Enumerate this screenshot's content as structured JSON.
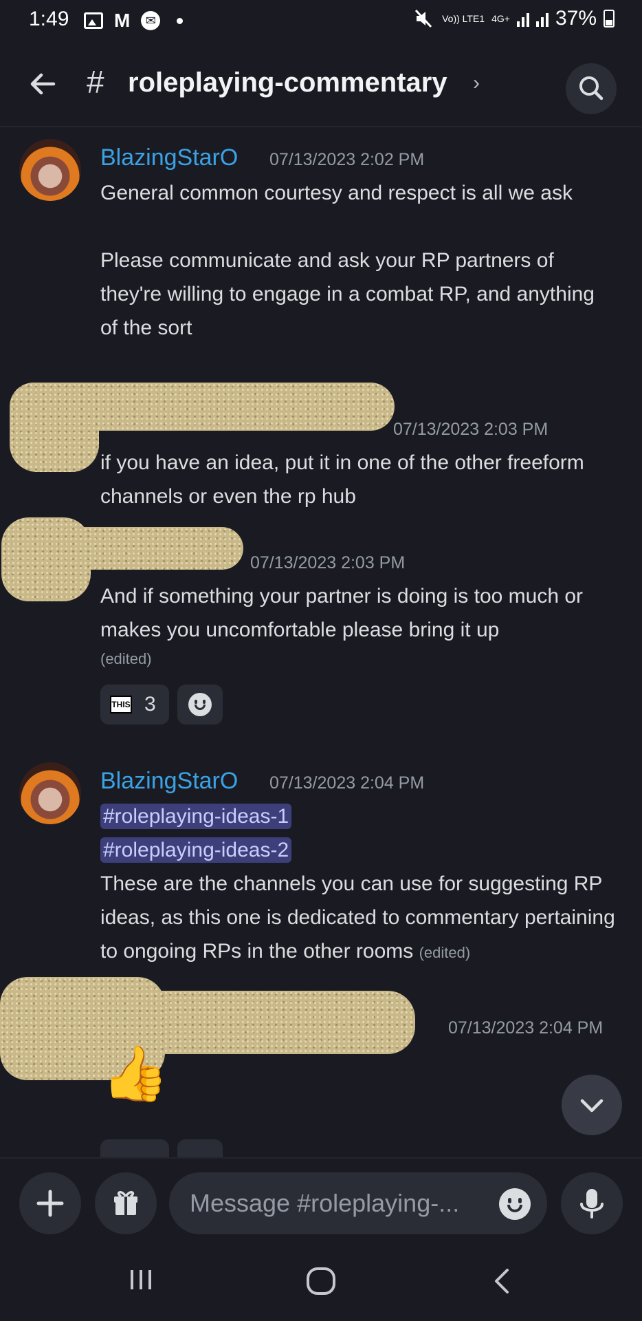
{
  "status_bar": {
    "time": "1:49",
    "mail_icon_label": "M",
    "messenger_icon_label": "✉",
    "volte_label": "Vo)) LTE1",
    "network_label": "4G+",
    "battery": "37%"
  },
  "header": {
    "hash": "#",
    "channel_name": "roleplaying-commentary",
    "chevron": "›"
  },
  "messages": [
    {
      "author": "BlazingStarO",
      "timestamp": "07/13/2023 2:02 PM",
      "paragraphs": [
        "General common courtesy and respect is all we ask",
        "Please communicate and ask your RP partners of they're willing to engage in a combat RP, and anything of the sort"
      ]
    },
    {
      "author": "",
      "timestamp": "07/13/2023 2:03 PM",
      "text": "if you have an idea, put it in one of the other freeform channels or even the rp hub"
    },
    {
      "author": "",
      "timestamp": "07/13/2023 2:03 PM",
      "text": "And if something your partner is doing is too much or makes you uncomfortable please bring it up",
      "edited": "(edited)",
      "reaction": {
        "emoji_label": "THIS",
        "count": "3"
      }
    },
    {
      "author": "BlazingStarO",
      "timestamp": "07/13/2023 2:04 PM",
      "mentions": [
        "#roleplaying-ideas-1",
        "#roleplaying-ideas-2"
      ],
      "text": "These are the channels you can use for suggesting RP ideas, as this one is dedicated to commentary pertaining to ongoing RPs in the other rooms",
      "edited": "(edited)"
    },
    {
      "author": "",
      "timestamp": "07/13/2023 2:04 PM",
      "emoji": "👍"
    }
  ],
  "composer": {
    "placeholder": "Message #roleplaying-..."
  },
  "colors": {
    "background": "#1a1b22",
    "author": "#3ba2e6",
    "mention_bg": "#3c3f7a",
    "redaction": "#c8b88a"
  }
}
